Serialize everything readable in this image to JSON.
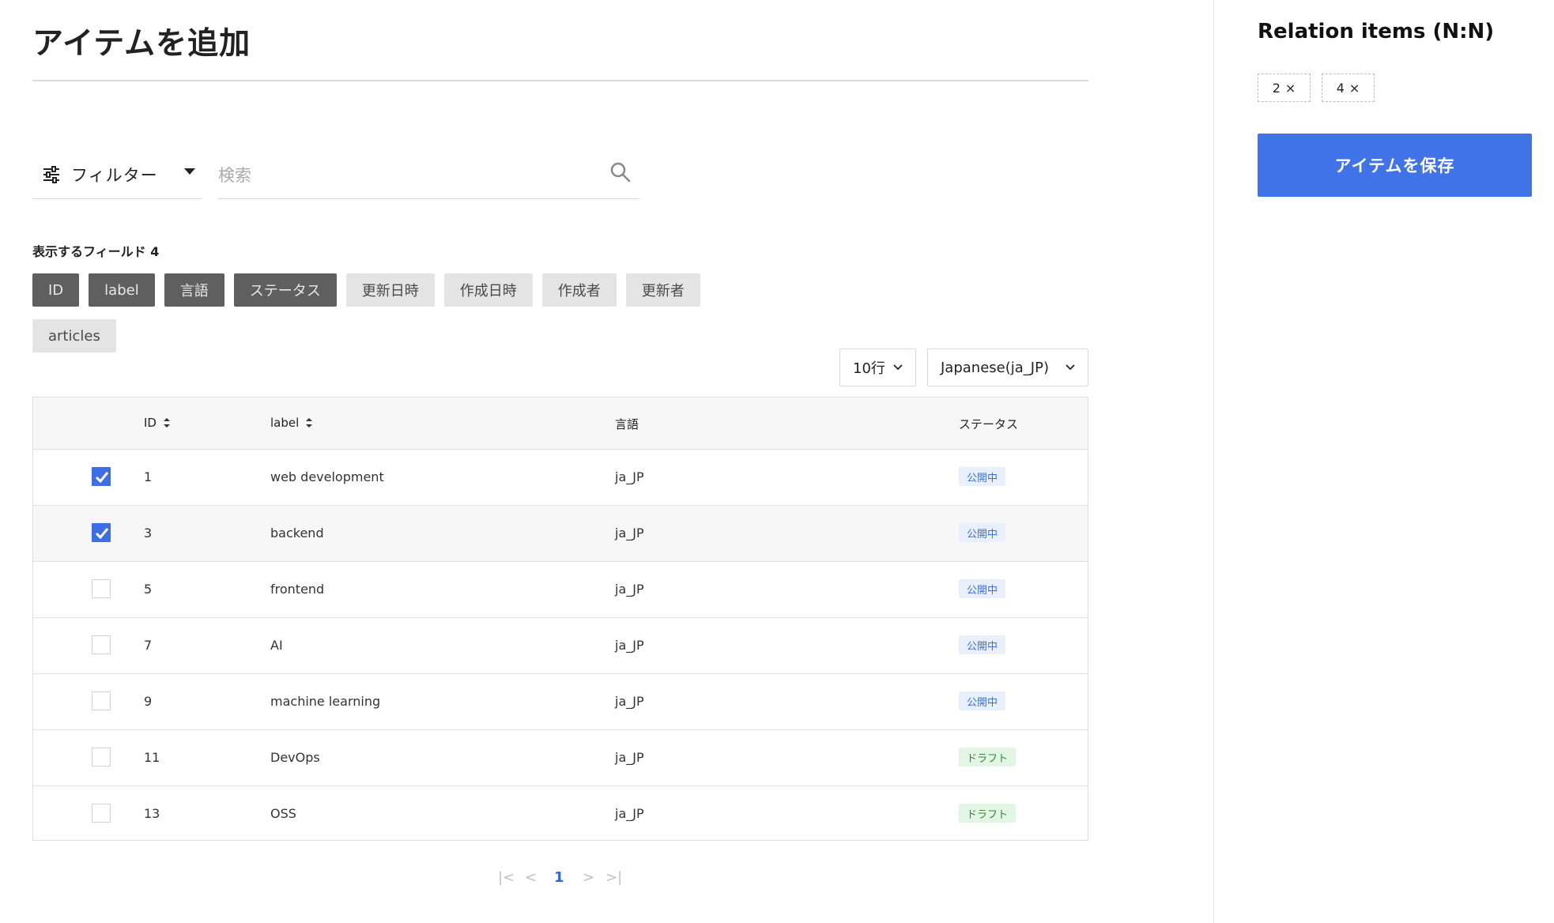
{
  "page": {
    "title": "アイテムを追加"
  },
  "filter": {
    "label": "フィルター",
    "search_placeholder": "検索"
  },
  "fields": {
    "label": "表示するフィールド 4",
    "chips": [
      {
        "label": "ID",
        "selected": true
      },
      {
        "label": "label",
        "selected": true
      },
      {
        "label": "言語",
        "selected": true
      },
      {
        "label": "ステータス",
        "selected": true
      },
      {
        "label": "更新日時",
        "selected": false
      },
      {
        "label": "作成日時",
        "selected": false
      },
      {
        "label": "作成者",
        "selected": false
      },
      {
        "label": "更新者",
        "selected": false
      },
      {
        "label": "articles",
        "selected": false
      }
    ]
  },
  "controls": {
    "rows_per_page": "10行",
    "language": "Japanese(ja_JP)"
  },
  "table": {
    "headers": {
      "id": "ID",
      "label": "label",
      "lang": "言語",
      "status": "ステータス"
    },
    "rows": [
      {
        "checked": true,
        "id": "1",
        "label": "web development",
        "lang": "ja_JP",
        "status": "公開中",
        "status_type": "published"
      },
      {
        "checked": true,
        "id": "3",
        "label": "backend",
        "lang": "ja_JP",
        "status": "公開中",
        "status_type": "published"
      },
      {
        "checked": false,
        "id": "5",
        "label": "frontend",
        "lang": "ja_JP",
        "status": "公開中",
        "status_type": "published"
      },
      {
        "checked": false,
        "id": "7",
        "label": "AI",
        "lang": "ja_JP",
        "status": "公開中",
        "status_type": "published"
      },
      {
        "checked": false,
        "id": "9",
        "label": "machine learning",
        "lang": "ja_JP",
        "status": "公開中",
        "status_type": "published"
      },
      {
        "checked": false,
        "id": "11",
        "label": "DevOps",
        "lang": "ja_JP",
        "status": "ドラフト",
        "status_type": "draft"
      },
      {
        "checked": false,
        "id": "13",
        "label": "OSS",
        "lang": "ja_JP",
        "status": "ドラフト",
        "status_type": "draft"
      }
    ]
  },
  "pagination": {
    "current_page": "1"
  },
  "relation": {
    "title": "Relation items (N:N)",
    "selected": [
      "2",
      "4"
    ],
    "remove_symbol": "×",
    "save_label": "アイテムを保存"
  },
  "colors": {
    "accent": "#4072e8",
    "checkbox": "#3d6ee6",
    "published_bg": "#e8f0fe",
    "published_fg": "#3d6ee6",
    "draft_bg": "#e3f6e3",
    "draft_fg": "#2e8b3a",
    "chip_selected": "#5f5f5f",
    "chip_unselected": "#e4e4e4"
  },
  "icons": [
    "filter-sliders-icon",
    "caret-down-icon",
    "search-icon",
    "sort-icon",
    "checkmark-icon",
    "chevron-down-icon",
    "first-page-icon",
    "prev-page-icon",
    "next-page-icon",
    "last-page-icon",
    "close-icon"
  ]
}
